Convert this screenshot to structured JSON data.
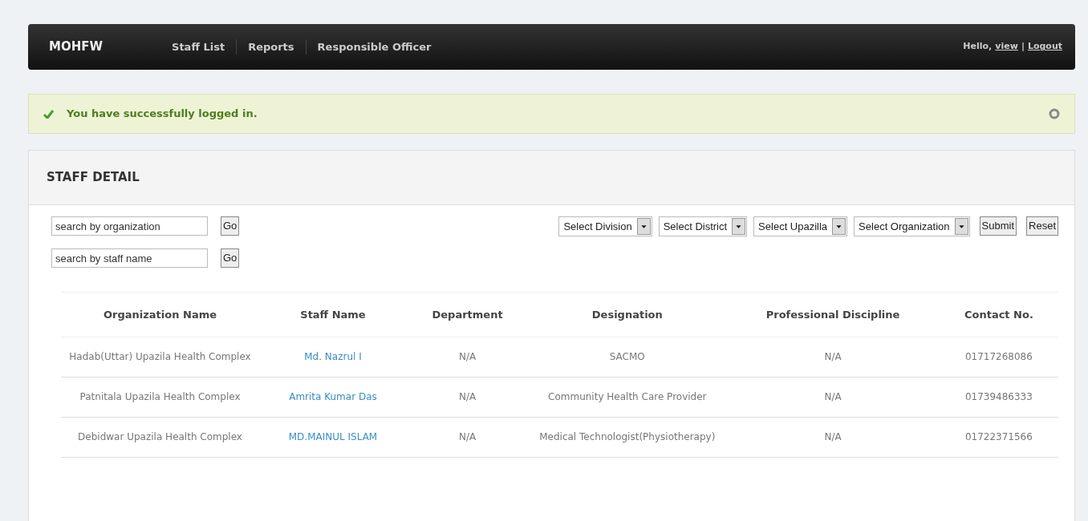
{
  "navbar": {
    "brand": "MOHFW",
    "links": [
      {
        "label": "Staff List"
      },
      {
        "label": "Reports"
      },
      {
        "label": "Responsible Officer"
      }
    ],
    "greeting": "Hello,",
    "user": "view",
    "separator": "|",
    "logout": "Logout"
  },
  "alert": {
    "message": "You have successfully logged in."
  },
  "panel": {
    "title": "STAFF DETAIL",
    "searches": [
      {
        "placeholder": "search by organization",
        "button": "Go"
      },
      {
        "placeholder": "search by staff name",
        "button": "Go"
      }
    ],
    "dropdowns": [
      "Select Division",
      "Select District",
      "Select Upazilla",
      "Select Organization"
    ],
    "buttons": [
      "Submit",
      "Reset"
    ],
    "table": {
      "columns": [
        "Organization Name",
        "Staff Name",
        "Department",
        "Designation",
        "Professional Discipline",
        "Contact No."
      ],
      "rows": [
        {
          "organization": "Hadab(Uttar) Upazila Health Complex",
          "staff": "Md. Nazrul I",
          "department": "N/A",
          "designation": "SACMO",
          "discipline": "N/A",
          "contact": "01717268086"
        },
        {
          "organization": "Patnitala Upazila Health Complex",
          "staff": "Amrita Kumar Das",
          "department": "N/A",
          "designation": "Community Health Care Provider",
          "discipline": "N/A",
          "contact": "01739486333"
        },
        {
          "organization": "Debidwar Upazila Health Complex",
          "staff": "MD.MAINUL ISLAM",
          "department": "N/A",
          "designation": "Medical Technologist(Physiotherapy)",
          "discipline": "N/A",
          "contact": "01722371566"
        }
      ]
    }
  }
}
